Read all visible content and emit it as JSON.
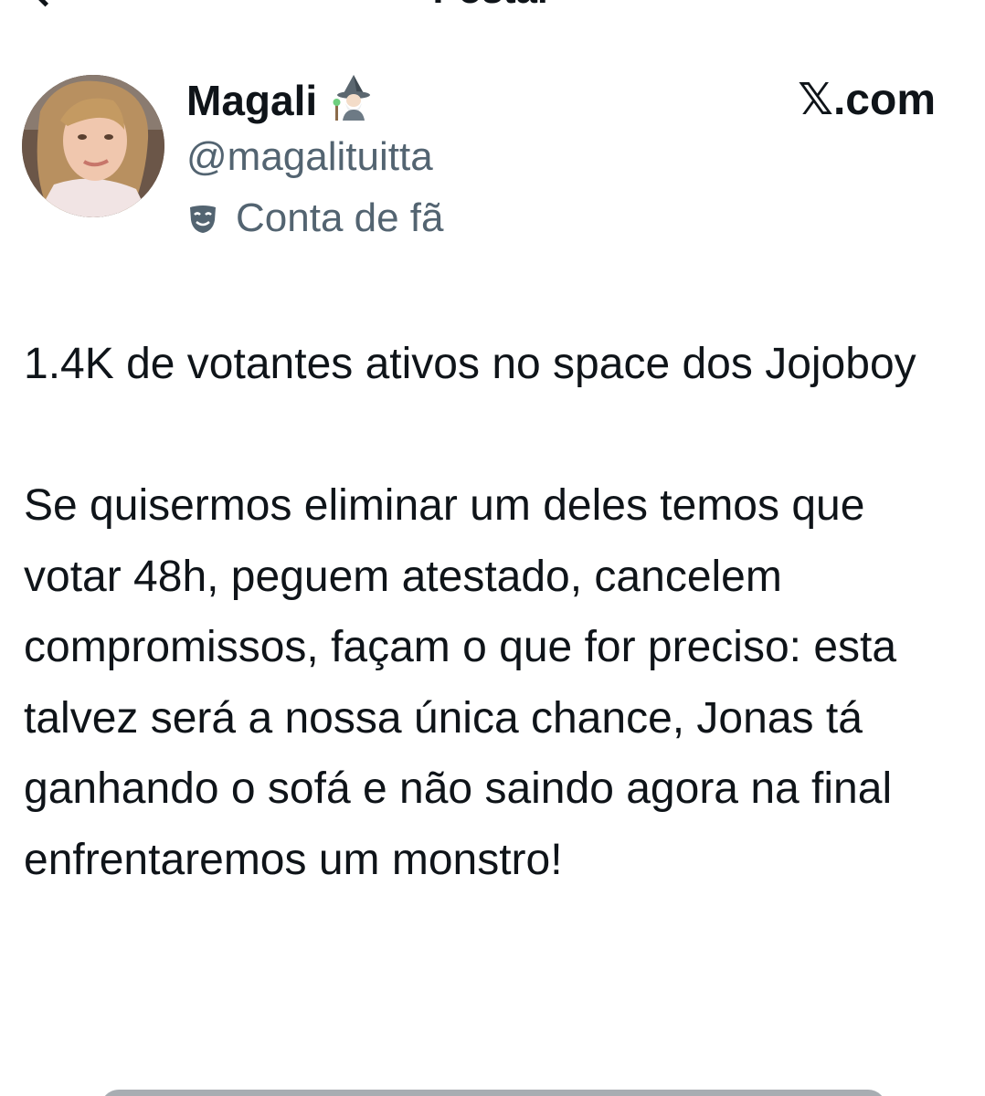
{
  "header": {
    "title": "Postar"
  },
  "post": {
    "author": {
      "display_name": "Magali",
      "name_emoji": "mage-icon",
      "handle": "@magalituitta",
      "affiliation_icon": "theater-mask-icon",
      "affiliation": "Conta de fã"
    },
    "source": "𝕏.com",
    "paragraphs": [
      "1.4K de votantes ativos no space dos Jojoboy",
      "Se quisermos eliminar um deles temos que votar 48h, peguem atestado, cancelem compromissos, façam o que for preciso: esta talvez será a nossa única chance, Jonas tá ganhando o sofá e não saindo agora na final enfrentaremos um monstro!"
    ]
  },
  "colors": {
    "text": "#0f1419",
    "secondary_text": "#536471",
    "background": "#ffffff"
  }
}
